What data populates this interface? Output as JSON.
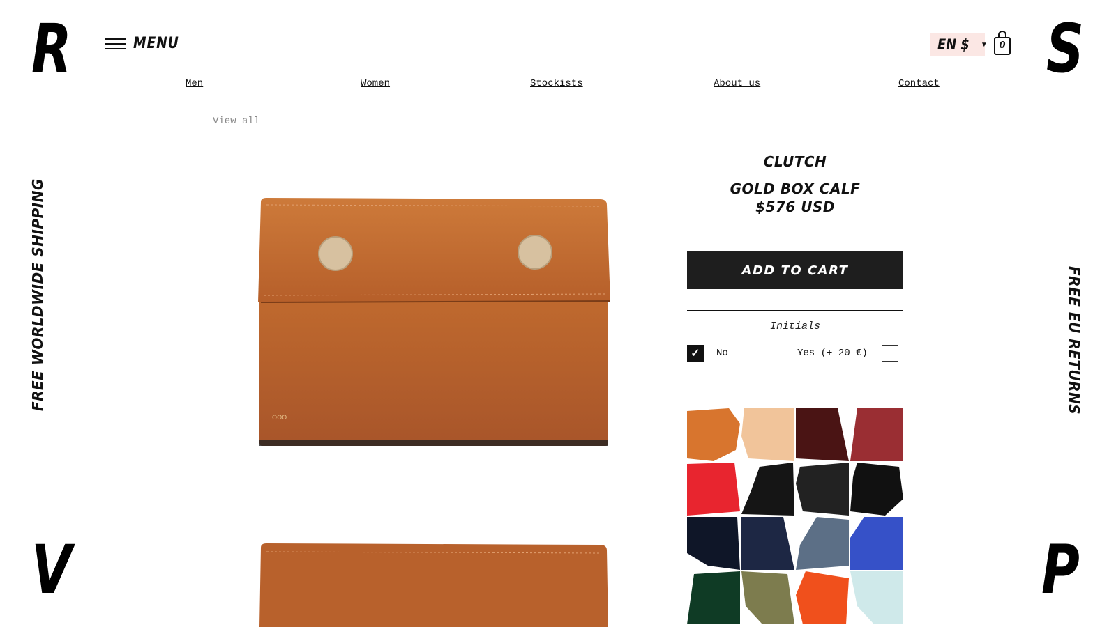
{
  "brand": {
    "corner_tl": "R",
    "corner_tr": "S",
    "corner_bl": "V",
    "corner_br": "P"
  },
  "header": {
    "menu_label": "MENU",
    "menu_icon": "hamburger-icon",
    "locale": "EN $",
    "locale_caret_icon": "caret-down-icon",
    "cart_icon": "shopping-bag-icon",
    "cart_count": "0"
  },
  "nav": {
    "items": [
      {
        "label": "Men"
      },
      {
        "label": "Women"
      },
      {
        "label": "Stockists"
      },
      {
        "label": "About us"
      },
      {
        "label": "Contact"
      }
    ]
  },
  "breadcrumb": {
    "view_all": "View all"
  },
  "side_banners": {
    "left": "FREE WORLDWIDE SHIPPING",
    "right": "FREE EU RETURNS"
  },
  "product": {
    "type": "CLUTCH",
    "name": "GOLD BOX CALF",
    "price": "$576 USD",
    "add_to_cart": "ADD TO CART",
    "initials_label": "Initials",
    "initials_options": [
      {
        "label": "No",
        "checked": true
      },
      {
        "label": "Yes (+ 20 €)",
        "checked": false
      }
    ],
    "leather_color": "#b8622a",
    "snap_color": "#d9c4a3"
  },
  "swatches": [
    {
      "color": "#d8752e"
    },
    {
      "color": "#f1c49a"
    },
    {
      "color": "#4a1414"
    },
    {
      "color": "#9a2e33"
    },
    {
      "color": "#e8252f"
    },
    {
      "color": "#151515"
    },
    {
      "color": "#222222"
    },
    {
      "color": "#111111"
    },
    {
      "color": "#0f1628"
    },
    {
      "color": "#1d2744"
    },
    {
      "color": "#5c6f86"
    },
    {
      "color": "#3651c8"
    },
    {
      "color": "#0f3b25"
    },
    {
      "color": "#7d7c4e"
    },
    {
      "color": "#f0501c"
    },
    {
      "color": "#cfe9ea"
    }
  ]
}
